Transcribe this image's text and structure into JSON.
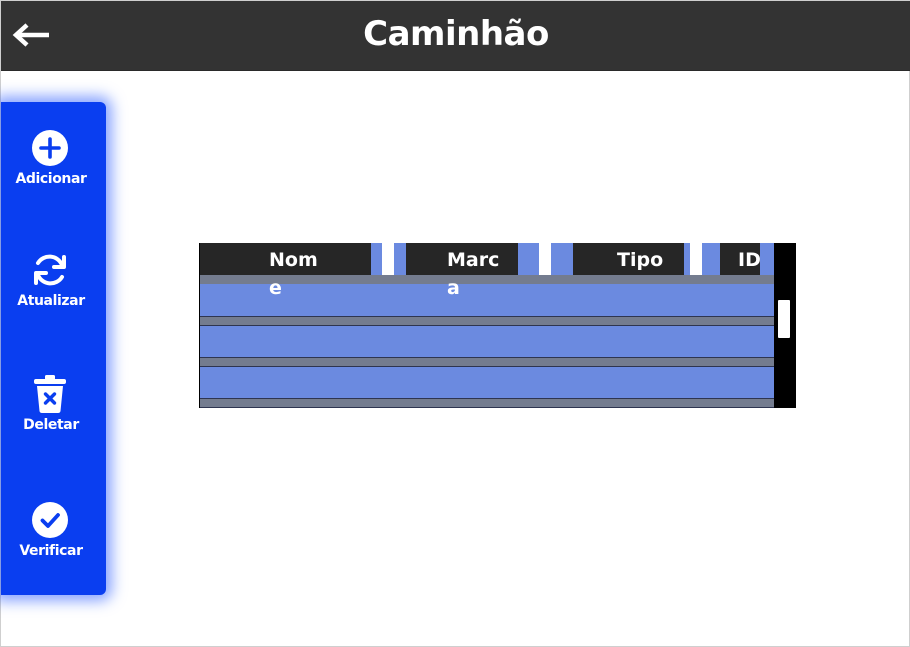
{
  "header": {
    "title": "Caminhão",
    "back_icon": "arrow-left-icon"
  },
  "sidebar": {
    "items": [
      {
        "label": "Adicionar",
        "icon": "plus-circle-icon"
      },
      {
        "label": "Atualizar",
        "icon": "refresh-icon"
      },
      {
        "label": "Deletar",
        "icon": "trash-icon"
      },
      {
        "label": "Verificar",
        "icon": "check-circle-icon"
      }
    ]
  },
  "table": {
    "columns": [
      {
        "label": "Nom",
        "overflow": "e"
      },
      {
        "label": "Marc",
        "overflow": "a"
      },
      {
        "label": "Tipo"
      },
      {
        "label": "ID"
      }
    ],
    "rows": [
      [],
      [],
      []
    ]
  },
  "colors": {
    "header_bg": "#333333",
    "sidebar_bg": "#0a3ef0",
    "row_bg": "#6b8ae0",
    "column_header_bg": "#262626"
  }
}
